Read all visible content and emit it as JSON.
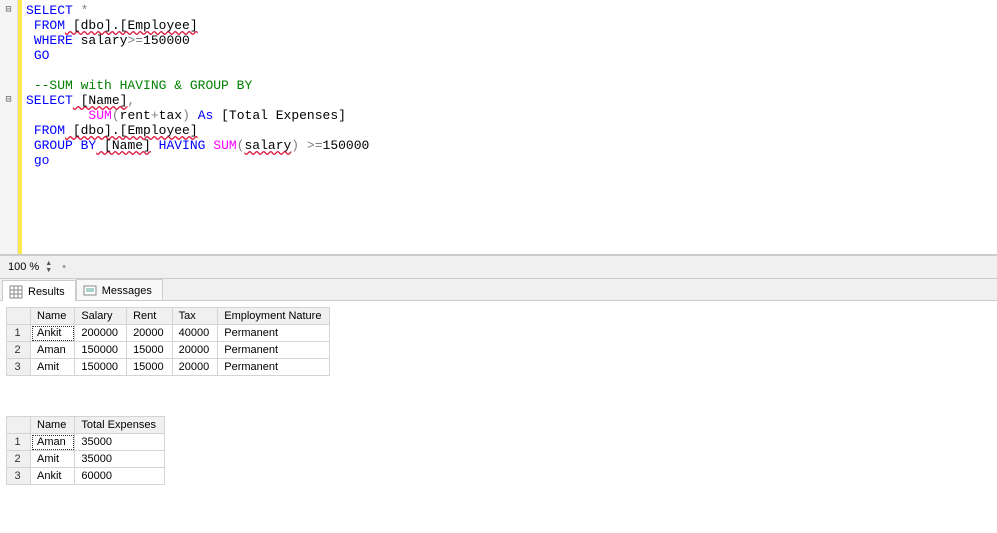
{
  "code": {
    "l1_minus": "⊟",
    "l1_kw1": "SELECT",
    "l1_star": " *",
    "l2_kw": "FROM",
    "l2_id": " [dbo].[Employee]",
    "l3_kw": "WHERE",
    "l3_id": " salary",
    "l3_op": ">=",
    "l3_num": "150000",
    "l4_kw": "GO",
    "l6_cm": "--SUM with HAVING & GROUP BY",
    "l7_minus": "⊟",
    "l7_kw": "SELECT",
    "l7_id": " [Name]",
    "l7_comma": ",",
    "l8_pad": "        ",
    "l8_fn": "SUM",
    "l8_par1": "(",
    "l8_arg": "rent",
    "l8_plus": "+",
    "l8_arg2": "tax",
    "l8_par2": ")",
    "l8_kw": " As ",
    "l8_id": "[Total Expenses]",
    "l9_kw": "FROM",
    "l9_id": " [dbo].[Employee]",
    "l10_kw1": "GROUP",
    "l10_kw2": " BY",
    "l10_id": " [Name]",
    "l10_kw3": " HAVING ",
    "l10_fn": "SUM",
    "l10_par1": "(",
    "l10_arg": "salary",
    "l10_par2": ")",
    "l10_op": " >=",
    "l10_num": "150000",
    "l11_kw": "go"
  },
  "zoom": {
    "value": "100 %",
    "bullet": "•"
  },
  "tabs": {
    "results": "Results",
    "messages": "Messages"
  },
  "grid1": {
    "headers": [
      "Name",
      "Salary",
      "Rent",
      "Tax",
      "Employment Nature"
    ],
    "rows": [
      {
        "n": "1",
        "c": [
          "Ankit",
          "200000",
          "20000",
          "40000",
          "Permanent"
        ]
      },
      {
        "n": "2",
        "c": [
          "Aman",
          "150000",
          "15000",
          "20000",
          "Permanent"
        ]
      },
      {
        "n": "3",
        "c": [
          "Amit",
          "150000",
          "15000",
          "20000",
          "Permanent"
        ]
      }
    ]
  },
  "grid2": {
    "headers": [
      "Name",
      "Total Expenses"
    ],
    "rows": [
      {
        "n": "1",
        "c": [
          "Aman",
          "35000"
        ]
      },
      {
        "n": "2",
        "c": [
          "Amit",
          "35000"
        ]
      },
      {
        "n": "3",
        "c": [
          "Ankit",
          "60000"
        ]
      }
    ]
  }
}
